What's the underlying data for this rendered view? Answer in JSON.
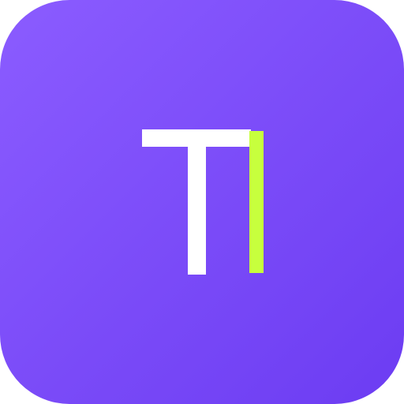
{
  "app_icon": {
    "background_gradient": [
      "#8B5CFF",
      "#6C3CF2"
    ],
    "glyph_color": "#FFFFFF",
    "cursor_color": "#C7FF3D"
  }
}
